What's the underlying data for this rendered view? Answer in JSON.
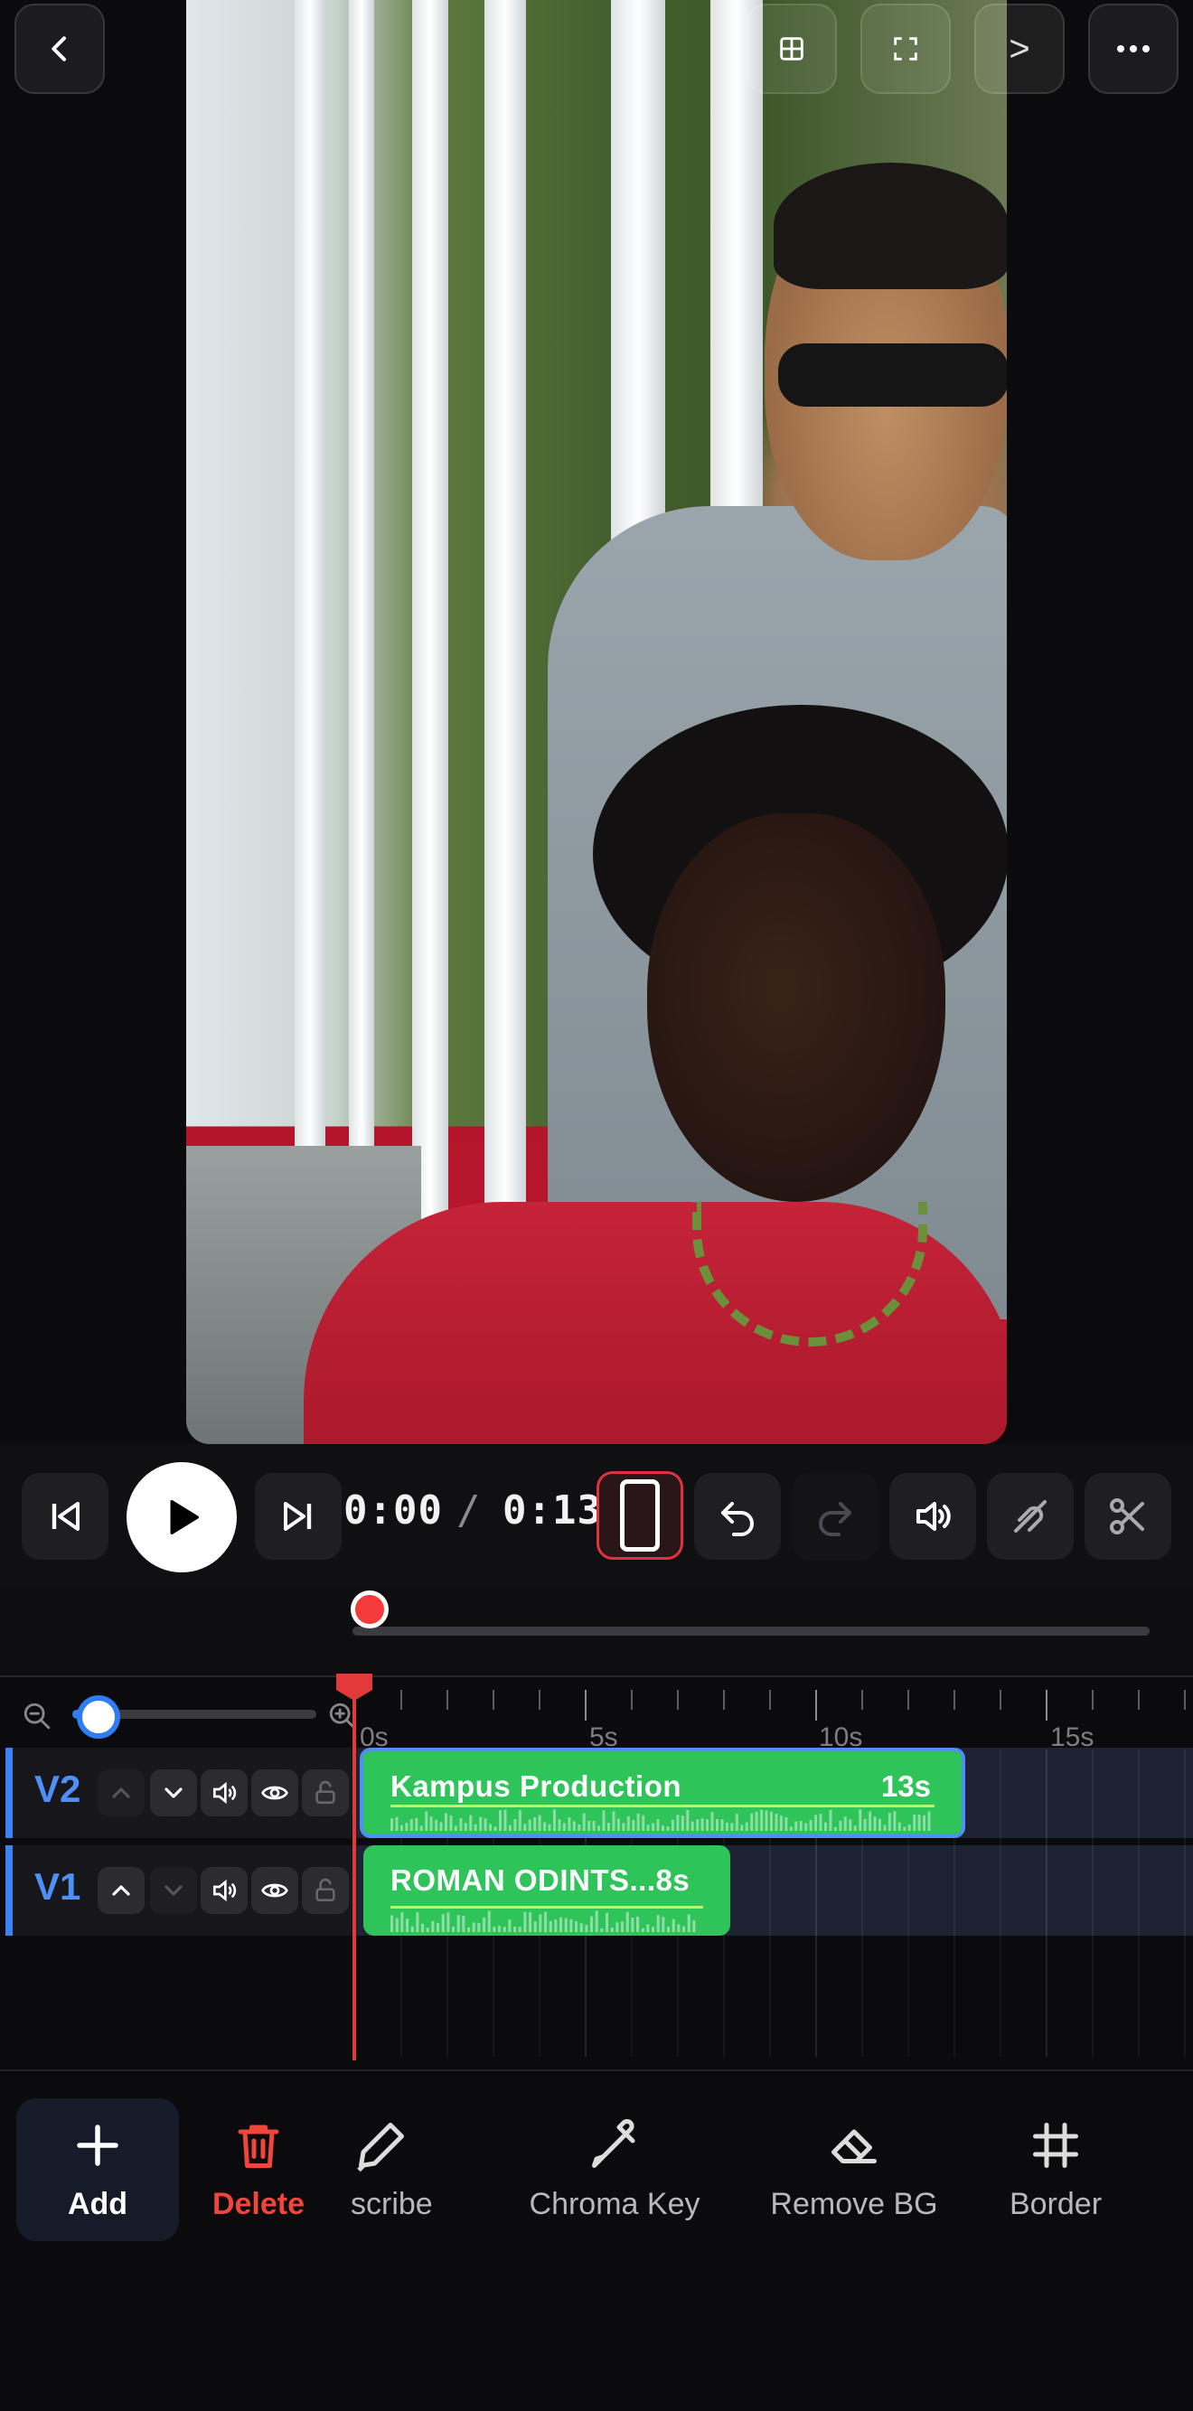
{
  "top_bar": {
    "back": "back-icon",
    "grid": "layout-grid-icon",
    "fullscreen": "fullscreen-icon",
    "next_label": ">",
    "more": "more-icon"
  },
  "player": {
    "current_time": "0:00",
    "separator": "/",
    "total_time": "0:13",
    "scrub_progress": 0
  },
  "timeline": {
    "ruler_labels": [
      "0s",
      "5s",
      "10s",
      "15s"
    ],
    "zoom_level": 0.05,
    "tracks": [
      {
        "name": "V2",
        "clip_label": "Kampus Production",
        "clip_duration": "13s",
        "selected": true
      },
      {
        "name": "V1",
        "clip_label": "ROMAN ODINTS...8s",
        "clip_duration": "",
        "selected": false
      }
    ]
  },
  "toolbar": {
    "items": [
      {
        "label": "Add",
        "icon": "plus-icon"
      },
      {
        "label": "Delete",
        "icon": "trash-icon"
      },
      {
        "label": "Transcribe",
        "icon": "pen-icon",
        "visible_label": "scribe"
      },
      {
        "label": "Chroma Key",
        "icon": "eyedropper-icon"
      },
      {
        "label": "Remove BG",
        "icon": "eraser-icon"
      },
      {
        "label": "Border",
        "icon": "border-grid-icon"
      }
    ]
  },
  "colors": {
    "accent_blue": "#3b82f6",
    "clip_green": "#2ec45a",
    "playhead_red": "#e23a3a",
    "delete_red": "#f0453c"
  }
}
